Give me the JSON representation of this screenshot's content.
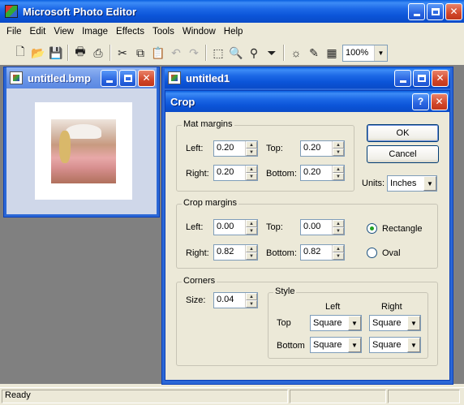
{
  "app": {
    "title": "Microsoft Photo Editor"
  },
  "menu": [
    "File",
    "Edit",
    "View",
    "Image",
    "Effects",
    "Tools",
    "Window",
    "Help"
  ],
  "toolbar": {
    "zoom": "100%"
  },
  "windows": {
    "bmp": {
      "title": "untitled.bmp"
    },
    "untitled1": {
      "title": "untitled1"
    }
  },
  "crop": {
    "title": "Crop",
    "help_label": "?",
    "ok_label": "OK",
    "cancel_label": "Cancel",
    "units_label": "Units:",
    "units_value": "Inches",
    "mat_margins": {
      "label": "Mat margins",
      "left_label": "Left:",
      "left": "0.20",
      "top_label": "Top:",
      "top": "0.20",
      "right_label": "Right:",
      "right": "0.20",
      "bottom_label": "Bottom:",
      "bottom": "0.20"
    },
    "crop_margins": {
      "label": "Crop margins",
      "left_label": "Left:",
      "left": "0.00",
      "top_label": "Top:",
      "top": "0.00",
      "right_label": "Right:",
      "right": "0.82",
      "bottom_label": "Bottom:",
      "bottom": "0.82",
      "rectangle_label": "Rectangle",
      "oval_label": "Oval",
      "selected_shape": "Rectangle"
    },
    "corners": {
      "label": "Corners",
      "size_label": "Size:",
      "size": "0.04",
      "style_label": "Style",
      "left_header": "Left",
      "right_header": "Right",
      "top_row_label": "Top",
      "bottom_row_label": "Bottom",
      "top_left": "Square",
      "top_right": "Square",
      "bottom_left": "Square",
      "bottom_right": "Square"
    }
  },
  "status": {
    "text": "Ready"
  }
}
